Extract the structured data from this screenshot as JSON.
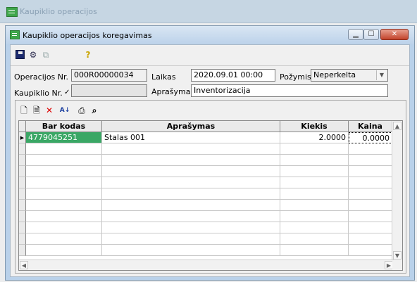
{
  "outer_window": {
    "title": "Kaupiklio operacijos"
  },
  "child_window": {
    "title": "Kaupiklio operacijos koregavimas"
  },
  "toolbar": {
    "save_icon": "save-icon",
    "settings_icon": "settings-icon",
    "copy_icon": "copy-icon",
    "help_icon": "help-icon"
  },
  "form": {
    "op_nr_label": "Operacijos Nr.",
    "op_nr_value": "000R00000034",
    "laikas_label": "Laikas",
    "laikas_value": "2020.09.01 00:00",
    "pozymis_label": "Požymis",
    "pozymis_value": "Neperkelta",
    "kaupiklio_label": "Kaupiklio Nr.",
    "kaupiklio_value": "",
    "aprasymas_label": "Aprašymas",
    "aprasymas_value": "Inventorizacija"
  },
  "grid_toolbar": {
    "new_icon": "new-icon",
    "edit_icon": "edit-icon",
    "delete_icon": "delete-icon",
    "sort_icon": "sort-icon",
    "print_icon": "print-icon",
    "find_icon": "find-icon"
  },
  "grid": {
    "columns": [
      "Bar kodas",
      "Aprašymas",
      "Kiekis",
      "Kaina"
    ],
    "rows": [
      {
        "bar": "4779045251",
        "aprasymas": "Stalas 001",
        "kiekis": "2.0000",
        "kaina": "0.0000"
      }
    ]
  },
  "colors": {
    "selection": "#3aa765",
    "title_bar": "#c6d6e3",
    "close_button": "#c2432b"
  }
}
